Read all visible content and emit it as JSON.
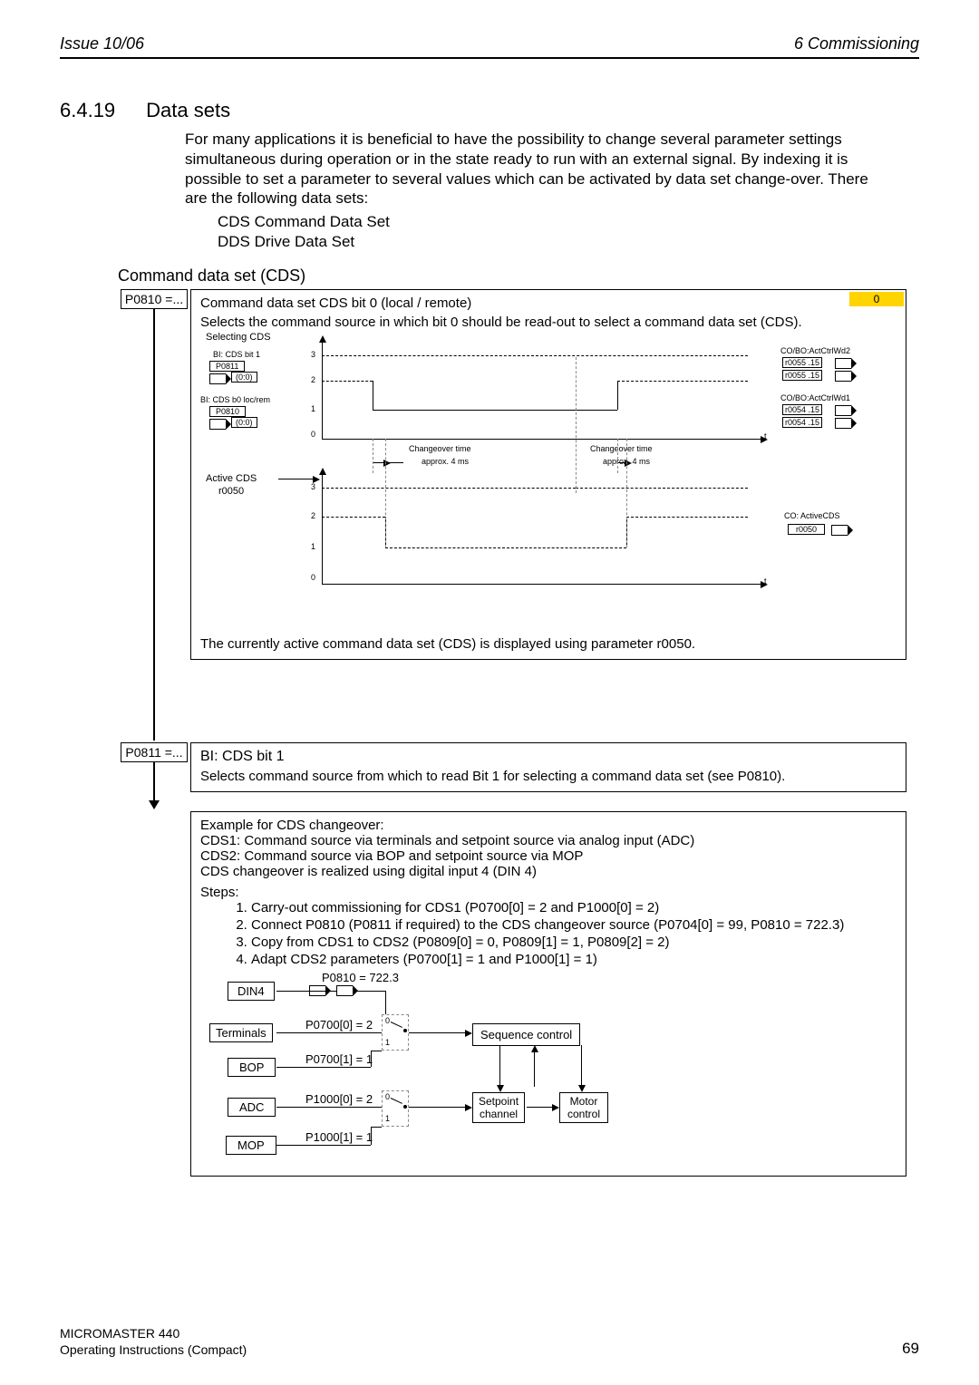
{
  "header": {
    "left": "Issue 10/06",
    "right": "6  Commissioning"
  },
  "section": {
    "number": "6.4.19",
    "title": "Data sets"
  },
  "intro": {
    "p": "For many applications it is beneficial to have the possibility to change several parameter settings simultaneous during operation or in the state ready to run with an external signal. By indexing it is possible to set a parameter to several values which can be activated by data set change-over. There are the following data sets:",
    "items": [
      "CDS Command Data Set",
      "DDS Drive Data Set"
    ]
  },
  "cds": {
    "heading": "Command data set (CDS)",
    "p0810": {
      "param": "P0810 =...",
      "title": "Command data set CDS bit 0 (local / remote)",
      "badge": "0",
      "desc": "Selects the command source in which bit 0 should be read-out to select a command data set (CDS).",
      "tail": "The currently active command data set (CDS) is displayed using parameter r0050.",
      "diagram": {
        "selecting": "Selecting CDS",
        "bi_bit1": "BI: CDS bit 1",
        "p0811": "P0811",
        "zero0": "(0:0)",
        "bi_b0": "BI: CDS b0 loc/rem",
        "p0810": "P0810",
        "active_cds": "Active CDS",
        "r0050": "r0050",
        "y_top": [
          "3",
          "2",
          "1",
          "0"
        ],
        "y_bot": [
          "3",
          "2",
          "1",
          "0"
        ],
        "changeover": "Changeover time",
        "approx": "approx. 4 ms",
        "t": "t",
        "cobo2": "CO/BO:ActCtrlWd2",
        "r0055": "r0055 .15",
        "cobo1": "CO/BO:ActCtrlWd1",
        "r0054": "r0054 .15",
        "co_active": "CO: ActiveCDS",
        "r0050_out": "r0050"
      }
    },
    "p0811": {
      "param": "P0811 =...",
      "title": "BI: CDS bit 1",
      "desc": "Selects command source from which to read Bit 1 for selecting a command data set (see P0810)."
    },
    "example": {
      "title": "Example for CDS changeover:",
      "l1": "CDS1: Command source via terminals and setpoint source via analog input (ADC)",
      "l2": "CDS2: Command source via BOP and setpoint source via MOP",
      "l3": "CDS changeover is realized using digital input 4 (DIN 4)",
      "steps_title": "Steps:",
      "steps": [
        "Carry-out commissioning for CDS1 (P0700[0] = 2 and P1000[0] = 2)",
        "Connect P0810 (P0811 if required) to the CDS changeover source (P0704[0] = 99, P0810 = 722.3)",
        "Copy from CDS1 to CDS2 (P0809[0] = 0, P0809[1] = 1, P0809[2] = 2)",
        "Adapt CDS2 parameters (P0700[1] = 1 and P1000[1] = 1)"
      ],
      "diagram": {
        "din4": "DIN4",
        "terminals": "Terminals",
        "bop": "BOP",
        "adc": "ADC",
        "mop": "MOP",
        "p0810": "P0810 = 722.3",
        "p0700_0": "P0700[0] = 2",
        "p0700_1": "P0700[1] = 1",
        "p1000_0": "P1000[0] = 2",
        "p1000_1": "P1000[1] = 1",
        "seq": "Sequence control",
        "setpoint": "Setpoint\nchannel",
        "motor": "Motor\ncontrol"
      }
    }
  },
  "footer": {
    "l1": "MICROMASTER 440",
    "l2": "Operating Instructions (Compact)",
    "page": "69"
  }
}
